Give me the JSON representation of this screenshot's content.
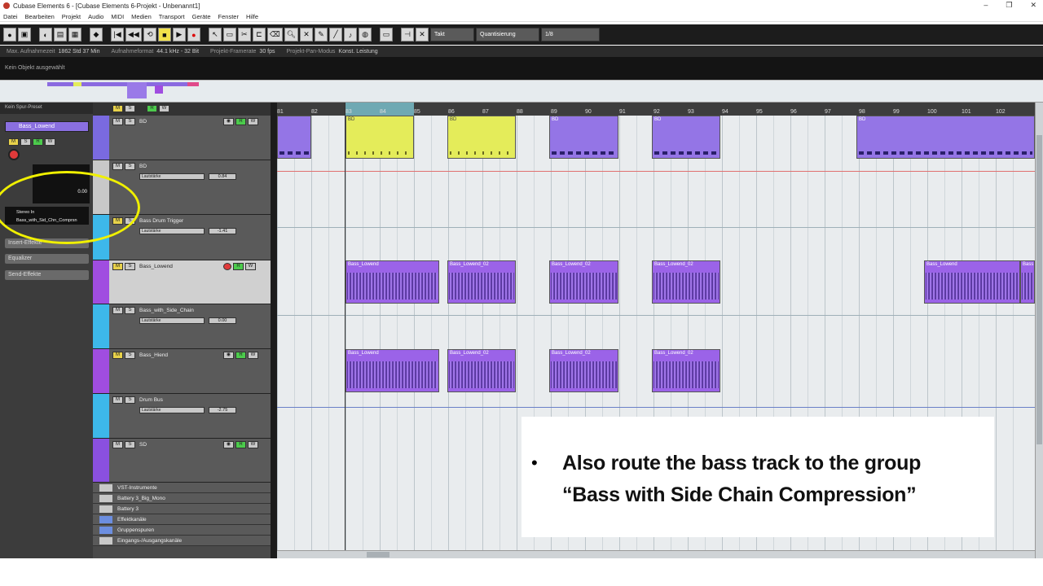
{
  "window": {
    "title": "Cubase Elements 6 - [Cubase Elements 6-Projekt - Unbenannt1]",
    "controls": [
      "–",
      "❐",
      "✕"
    ]
  },
  "menu": [
    "Datei",
    "Bearbeiten",
    "Projekt",
    "Audio",
    "MIDI",
    "Medien",
    "Transport",
    "Geräte",
    "Fenster",
    "Hilfe"
  ],
  "toolbar": {
    "quantize_label": "Quantisierung",
    "iq_value": "1/8",
    "grid_label": "Takt"
  },
  "status": [
    {
      "label": "Max. Aufnahmezeit",
      "value": "1862 Std 37 Min"
    },
    {
      "label": "Aufnahmeformat",
      "value": "44.1 kHz - 32 Bit"
    },
    {
      "label": "Projekt-Framerate",
      "value": "30 fps"
    },
    {
      "label": "Projekt-Pan-Modus",
      "value": "Konst. Leistung"
    }
  ],
  "info": "Kein Objekt ausgewählt",
  "inspector": {
    "preset": "Kein Spur-Preset",
    "track": "Bass_Lowend",
    "value": "0.00",
    "input": "Stereo In",
    "output": "Bass_with_Sid_Chn_Comprsn",
    "sections": [
      "Insert-Effekte",
      "Equalizer",
      "Send-Effekte"
    ]
  },
  "tracks": [
    {
      "name": "BD",
      "color": "#7a6ae0",
      "value": ""
    },
    {
      "name": "BD",
      "color": "#c8c8c8",
      "value": "0.84",
      "vol": "Lautstärke"
    },
    {
      "name": "Bass Drum Trigger",
      "color": "#3db8ea",
      "value": "-1.41",
      "vol": "Lautstärke"
    },
    {
      "name": "Bass_Lowend",
      "color": "#a04de0",
      "value": ""
    },
    {
      "name": "Bass_with_Side_Chain",
      "color": "#3db8ea",
      "value": "0.00",
      "vol": "Lautstärke"
    },
    {
      "name": "Bass_Hiend",
      "color": "#a04de0",
      "value": ""
    },
    {
      "name": "Drum Bus",
      "color": "#3db8ea",
      "value": "-2.75",
      "vol": "Lautstärke"
    },
    {
      "name": "SD",
      "color": "#8a50e0",
      "value": ""
    }
  ],
  "folders": [
    "VST-Instrumente",
    "Battery 3_Big_Mono",
    "Battery 3",
    "Effektkanäle",
    "Gruppenspuren",
    "Eingangs-/Ausgangskanäle"
  ],
  "ruler": [
    "81",
    "82",
    "83",
    "84",
    "85",
    "86",
    "87",
    "88",
    "89",
    "90",
    "91",
    "92",
    "93",
    "94",
    "95",
    "96",
    "97",
    "98",
    "99",
    "100",
    "101",
    "102"
  ],
  "clips": {
    "bd": "BD",
    "lowend": [
      "Bass_Lowend",
      "Bass_Lowend_02",
      "Bass_Lowend_02",
      "Bass_Lowend_02",
      "Bass_Lowend",
      "Bass"
    ],
    "hiend": [
      "Bass_Lowend",
      "Bass_Lowend_02",
      "Bass_Lowend_02",
      "Bass_Lowend_02"
    ]
  },
  "overlay": {
    "bullet": "•",
    "line1": "Also route the bass track to the group",
    "line2": "“Bass with Side Chain Compression”"
  }
}
